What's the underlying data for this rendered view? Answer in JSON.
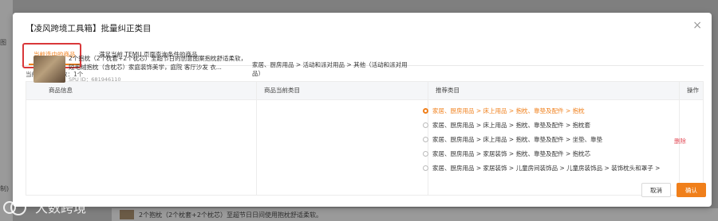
{
  "background": {
    "left_texts": [
      "图",
      "制)"
    ],
    "bottom_row_text": "2个抱枕（2个枕套+2个枕芯）至超节日日间使用抱枕舒适柔软。"
  },
  "watermark": {
    "text": "大数跨境"
  },
  "modal": {
    "title": "【凌风跨境工具箱】批量纠正类目",
    "close_icon": "×"
  },
  "tabs": [
    {
      "label": "当前选中的商品",
      "active": true
    },
    {
      "label": "满足当前 TEMU 页面查询条件的商品",
      "active": false
    }
  ],
  "count_text": "当前列表商品数：1个",
  "table": {
    "headers": [
      "商品信息",
      "商品当前类目",
      "推荐类目",
      "操作"
    ],
    "product": {
      "title": "2个抱枕（2个枕套+2个枕芯）至超节日的创意图案抱枕舒适柔软，短毛绒抱枕（含枕芯）家庭装饰美学，庭院 客厅沙发 衣...",
      "spu": "SPU ID：681946110"
    },
    "current_category": "家居、厨房用品 > 活动和派对用品 > 其他（活动和派对用品）",
    "options": [
      {
        "label": "家居、厨房用品 > 床上用品 > 抱枕、靠垫及配件 > 抱枕",
        "selected": true
      },
      {
        "label": "家居、厨房用品 > 床上用品 > 抱枕、靠垫及配件 > 抱枕套",
        "selected": false
      },
      {
        "label": "家居、厨房用品 > 床上用品 > 抱枕、靠垫及配件 > 坐垫、靠垫",
        "selected": false
      },
      {
        "label": "家居、厨房用品 > 家居装饰 > 抱枕、靠垫及配件 > 抱枕芯",
        "selected": false
      },
      {
        "label": "家居、厨房用品 > 家居装饰 > 儿童房间装饰品 > 儿童房装饰品 > 装饰枕头和罩子 >",
        "selected": false
      }
    ],
    "delete_label": "删除"
  },
  "buttons": {
    "cancel": "取消",
    "ok": "确认"
  },
  "colors": {
    "accent": "#f07f1a",
    "danger": "#e34d59",
    "highlight_box": "#d9383a"
  }
}
